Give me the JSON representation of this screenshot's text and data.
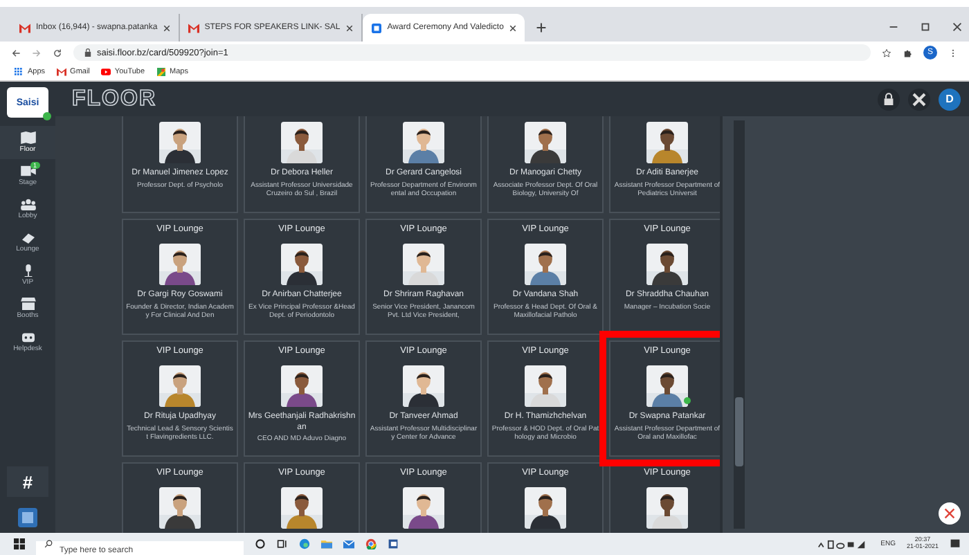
{
  "browser": {
    "tabs": [
      {
        "kind": "mail",
        "label": "Inbox (16,944) - swapna.patanka",
        "selected": false
      },
      {
        "kind": "mail",
        "label": "STEPS FOR SPEAKERS LINK- SAL",
        "selected": false
      },
      {
        "kind": "page",
        "label": "Award Ceremony And Valedicto",
        "selected": true
      }
    ],
    "address": "saisi.floor.bz/card/509920?join=1",
    "profile": "S",
    "bookmarks": [
      {
        "kind": "apps",
        "label": "Apps"
      },
      {
        "kind": "mail",
        "label": "Gmail"
      },
      {
        "kind": "video",
        "label": "YouTube"
      },
      {
        "kind": "map",
        "label": "Maps"
      }
    ]
  },
  "app": {
    "logo": "Saisi",
    "title": "FLOOR",
    "avatar": "D",
    "nav": [
      {
        "label": "Floor",
        "selected": true
      },
      {
        "label": "Stage",
        "selected": false,
        "badge": "1"
      },
      {
        "label": "Lobby",
        "selected": false
      },
      {
        "label": "Lounge",
        "selected": false
      },
      {
        "label": "VIP",
        "selected": false
      },
      {
        "label": "Booths",
        "selected": false
      },
      {
        "label": "Helpdesk",
        "selected": false
      }
    ],
    "channel_button": "#",
    "cards": [
      {
        "name": "Dr Manuel Jimenez Lopez",
        "title": "Professor Dept. of Psycholo",
        "online": false,
        "highlighted": false
      },
      {
        "name": "Dr Debora Heller",
        "title": "Assistant Professor Universidade Cruzeiro do Sul , Brazil",
        "online": false,
        "highlighted": false
      },
      {
        "name": "Dr Gerard Cangelosi",
        "title": "Professor Department of Environmental and Occupation",
        "online": false,
        "highlighted": false
      },
      {
        "name": "Dr Manogari Chetty",
        "title": "Associate Professor Dept. Of Oral Biology, University Of",
        "online": false,
        "highlighted": false
      },
      {
        "name": "Dr Aditi Banerjee",
        "title": "Assistant Professor Department of Pediatrics Universit",
        "online": false,
        "highlighted": false
      },
      {
        "lounge": "VIP Lounge",
        "name": "Dr Gargi Roy Goswami",
        "title": "Founder & Director, Indian Academy For Clinical And Den",
        "online": false,
        "highlighted": false
      },
      {
        "lounge": "VIP Lounge",
        "name": "Dr Anirban Chatterjee",
        "title": "Ex Vice Principal Professor &Head Dept. of Periodontolo",
        "online": false,
        "highlighted": false
      },
      {
        "lounge": "VIP Lounge",
        "name": "Dr Shriram Raghavan",
        "title": "Senior Vice President, Janancom Pvt. Ltd Vice President,",
        "online": false,
        "highlighted": false
      },
      {
        "lounge": "VIP Lounge",
        "name": "Dr Vandana Shah",
        "title": "Professor & Head Dept. Of Oral & Maxillofacial Patholo",
        "online": false,
        "highlighted": false
      },
      {
        "lounge": "VIP Lounge",
        "name": "Dr Shraddha Chauhan",
        "title": "Manager – Incubation Socie",
        "online": false,
        "highlighted": false
      },
      {
        "lounge": "VIP Lounge",
        "name": "Dr Rituja Upadhyay",
        "title": "Technical Lead & Sensory Scientist Flavingredients LLC.",
        "online": false,
        "highlighted": false
      },
      {
        "lounge": "VIP Lounge",
        "name": "Mrs Geethanjali Radhakrishnan",
        "title": "CEO AND MD Aduvo Diagno",
        "online": false,
        "highlighted": false
      },
      {
        "lounge": "VIP Lounge",
        "name": "Dr Tanveer Ahmad",
        "title": "Assistant Professor Multidisciplinary Center for Advance",
        "online": false,
        "highlighted": false
      },
      {
        "lounge": "VIP Lounge",
        "name": "Dr H. Thamizhchelvan",
        "title": "Professor & HOD Dept. of Oral Pathology and Microbio",
        "online": false,
        "highlighted": false
      },
      {
        "lounge": "VIP Lounge",
        "name": "Dr Swapna Patankar",
        "title": "Assistant Professor Department of Oral and Maxillofac",
        "online": true,
        "highlighted": true
      },
      {
        "lounge": "VIP Lounge",
        "online": false,
        "highlighted": false
      },
      {
        "lounge": "VIP Lounge",
        "online": false,
        "highlighted": false
      },
      {
        "lounge": "VIP Lounge",
        "online": false,
        "highlighted": false
      },
      {
        "lounge": "VIP Lounge",
        "online": false,
        "highlighted": false
      },
      {
        "lounge": "VIP Lounge",
        "online": false,
        "highlighted": false
      }
    ]
  },
  "taskbar": {
    "search_placeholder": "Type here to search",
    "language": "ENG",
    "time": "20:37",
    "date": "21-01-2021"
  }
}
